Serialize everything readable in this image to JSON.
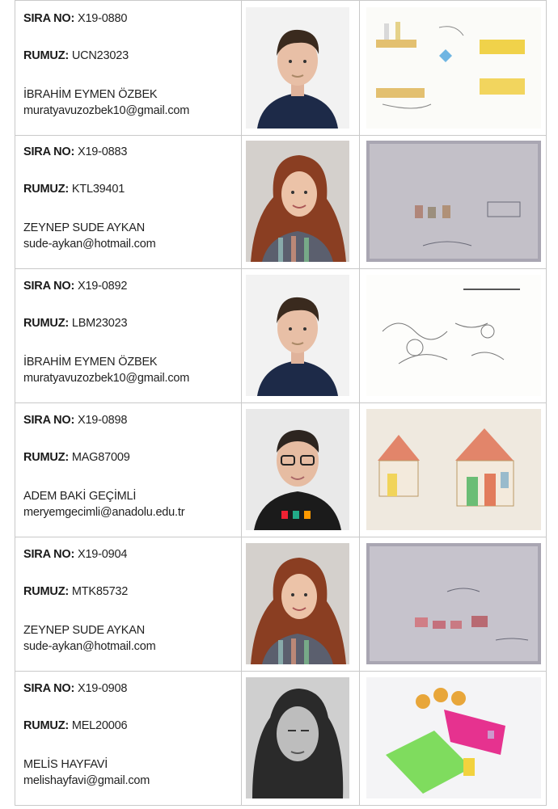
{
  "labels": {
    "sira_no": "SIRA NO:",
    "rumuz": "RUMUZ:"
  },
  "entries": [
    {
      "sira_no": "X19-0880",
      "rumuz": "UCN23023",
      "name": "İBRAHİM EYMEN ÖZBEK",
      "email": "muratyavuzozbek10@gmail.com"
    },
    {
      "sira_no": "X19-0883",
      "rumuz": "KTL39401",
      "name": "ZEYNEP SUDE AYKAN",
      "email": "sude-aykan@hotmail.com"
    },
    {
      "sira_no": "X19-0892",
      "rumuz": "LBM23023",
      "name": "İBRAHİM EYMEN ÖZBEK",
      "email": "muratyavuzozbek10@gmail.com"
    },
    {
      "sira_no": "X19-0898",
      "rumuz": "MAG87009",
      "name": "ADEM BAKİ GEÇİMLİ",
      "email": "meryemgecimli@anadolu.edu.tr"
    },
    {
      "sira_no": "X19-0904",
      "rumuz": "MTK85732",
      "name": "ZEYNEP SUDE AYKAN",
      "email": "sude-aykan@hotmail.com"
    },
    {
      "sira_no": "X19-0908",
      "rumuz": "MEL20006",
      "name": "MELİS HAYFAVİ",
      "email": "melishayfavi@gmail.com"
    }
  ],
  "colors": {
    "border": "#c9c9c9",
    "text": "#222222"
  }
}
